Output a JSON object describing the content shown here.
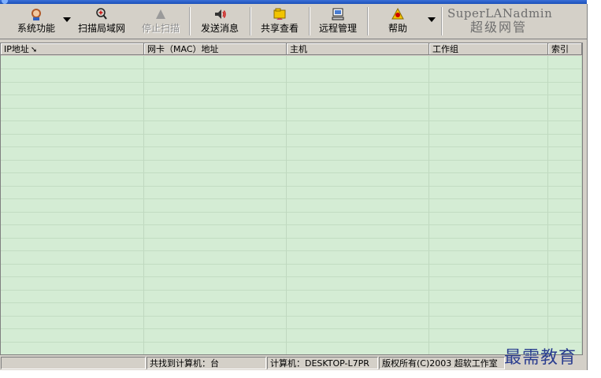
{
  "toolbar": {
    "system_label": "系统功能",
    "scan_label": "扫描局域网",
    "stop_label": "停止扫描",
    "send_label": "发送消息",
    "share_label": "共享查看",
    "remote_label": "远程管理",
    "help_label": "帮助"
  },
  "brand": {
    "en": "SuperLANadmin",
    "cn": "超级网管"
  },
  "table": {
    "columns": [
      "IP地址",
      "网卡（MAC）地址",
      "主机",
      "工作组",
      "索引"
    ],
    "row_count": 23
  },
  "status": {
    "found": "共找到计算机：台",
    "computer": "计算机：DESKTOP-L7PR",
    "copyright": "版权所有(C)2003  超软工作室"
  },
  "watermark": "最需教育",
  "colors": {
    "grid_bg": "#d4ecd4",
    "chrome": "#d4d0c8"
  }
}
